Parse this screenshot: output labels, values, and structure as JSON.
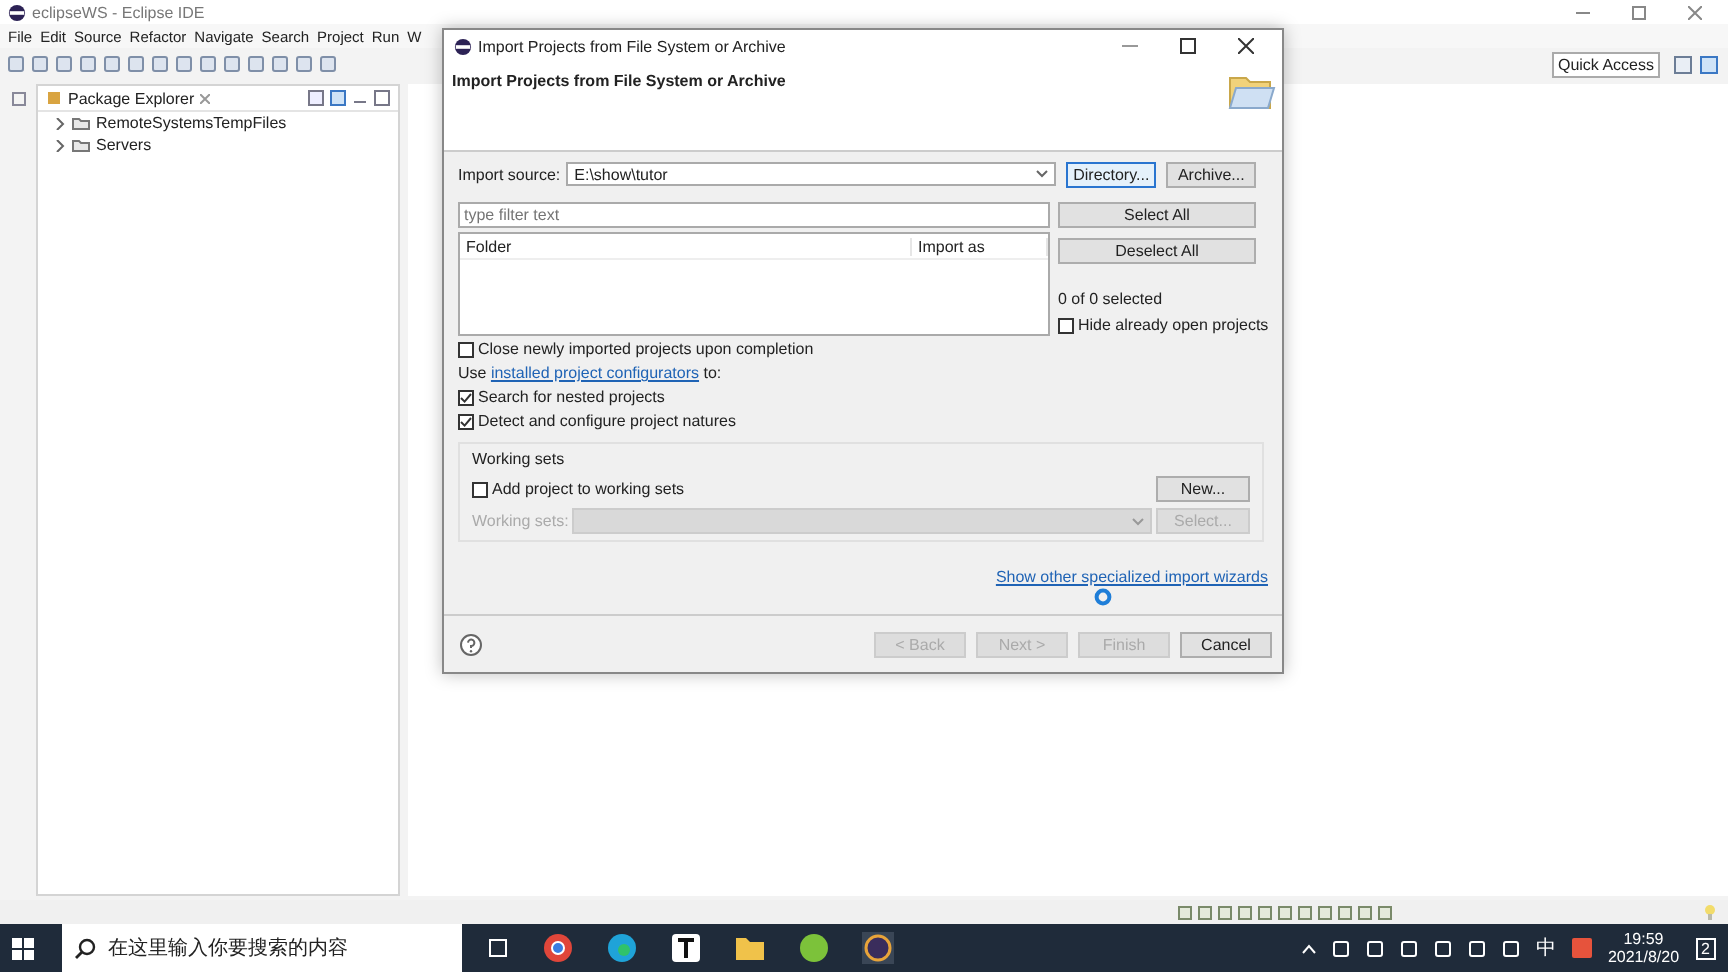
{
  "window": {
    "title": "eclipseWS - Eclipse IDE"
  },
  "menu": [
    "File",
    "Edit",
    "Source",
    "Refactor",
    "Navigate",
    "Search",
    "Project",
    "Run",
    "W"
  ],
  "quick_access": "Quick Access",
  "package_explorer": {
    "title": "Package Explorer",
    "items": [
      {
        "label": "RemoteSystemsTempFiles",
        "expanded": false
      },
      {
        "label": "Servers",
        "expanded": false
      }
    ]
  },
  "dialog": {
    "title": "Import Projects from File System or Archive",
    "heading": "Import Projects from File System or Archive",
    "import_source": {
      "label": "Import source:",
      "value": "E:\\show\\tutor"
    },
    "source_buttons": [
      "Directory...",
      "Archive..."
    ],
    "filter": {
      "placeholder": "type filter text"
    },
    "columns": [
      "Folder",
      "Import as"
    ],
    "side_buttons": [
      "Select All",
      "Deselect All"
    ],
    "selected_count": "0 of 0 selected",
    "hide_open": {
      "label": "Hide already open projects",
      "checked": false
    },
    "options": [
      {
        "kind": "checkbox",
        "label": "Close newly imported projects upon completion",
        "checked": false
      },
      {
        "kind": "text",
        "before": "Use",
        "link": "installed project configurators",
        "after": "to:"
      },
      {
        "kind": "checkbox",
        "label": "Search for nested projects",
        "checked": true
      },
      {
        "kind": "checkbox",
        "label": "Detect and configure project natures",
        "checked": true
      }
    ],
    "working_sets": {
      "title": "Working sets",
      "add": {
        "label": "Add project to working sets",
        "checked": false
      },
      "new_button": "New...",
      "sets_label": "Working sets:",
      "select_button": "Select...",
      "disabled": true
    },
    "wizards_link": "Show other specialized import wizards",
    "footer_buttons": [
      {
        "label": "< Back",
        "disabled": true
      },
      {
        "label": "Next >",
        "disabled": true
      },
      {
        "label": "Finish",
        "disabled": true
      },
      {
        "label": "Cancel",
        "disabled": false
      }
    ]
  },
  "taskbar": {
    "search_placeholder": "在这里输入你要搜索的内容",
    "ime": "中",
    "time": "19:59",
    "date": "2021/8/20",
    "notifications": "2"
  }
}
